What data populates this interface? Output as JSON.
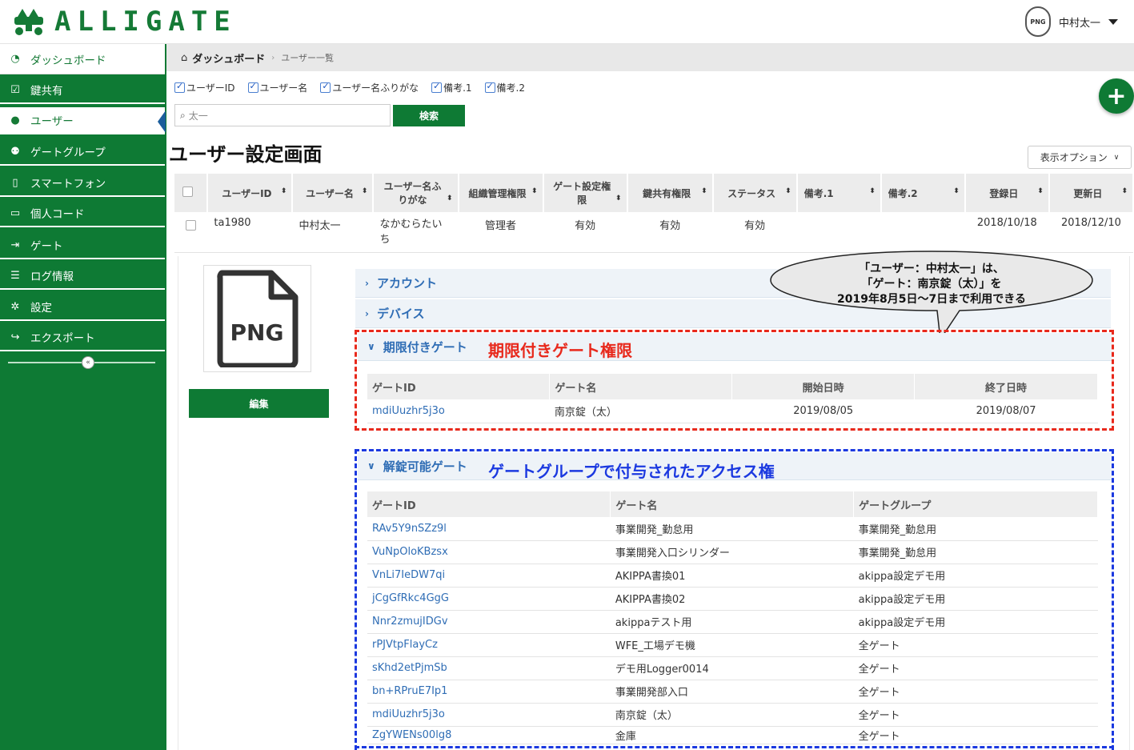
{
  "app": {
    "logo_text": "ALLIGATE"
  },
  "header": {
    "avatar_label": "PNG",
    "user_name": "中村太一"
  },
  "sidebar": {
    "items": [
      {
        "label": "ダッシュボード",
        "icon": "dashboard-icon"
      },
      {
        "label": "鍵共有",
        "icon": "check-square-icon"
      },
      {
        "label": "ユーザー",
        "icon": "user-icon"
      },
      {
        "label": "ゲートグループ",
        "icon": "users-icon"
      },
      {
        "label": "スマートフォン",
        "icon": "mobile-icon"
      },
      {
        "label": "個人コード",
        "icon": "card-icon"
      },
      {
        "label": "ゲート",
        "icon": "sign-in-icon"
      },
      {
        "label": "ログ情報",
        "icon": "list-icon"
      },
      {
        "label": "設定",
        "icon": "gear-icon"
      },
      {
        "label": "エクスポート",
        "icon": "share-icon"
      }
    ]
  },
  "breadcrumb": {
    "home": "ダッシュボード",
    "current": "ユーザー一覧"
  },
  "filters": {
    "checkboxes": [
      "ユーザーID",
      "ユーザー名",
      "ユーザー名ふりがな",
      "備考.1",
      "備考.2"
    ],
    "search_value": "太一",
    "search_button": "検索"
  },
  "page_title": "ユーザー設定画面",
  "view_options": "表示オプション",
  "users_table": {
    "headers": [
      "ユーザーID",
      "ユーザー名",
      "ユーザー名ふりがな",
      "組織管理権限",
      "ゲート設定権限",
      "鍵共有権限",
      "ステータス",
      "備考.1",
      "備考.2",
      "登録日",
      "更新日"
    ],
    "row": [
      "ta1980",
      "中村太一",
      "なかむらたいち",
      "管理者",
      "有効",
      "有効",
      "有効",
      "",
      "",
      "2018/10/18",
      "2018/12/10"
    ]
  },
  "detail": {
    "image_label": "PNG",
    "edit_button": "編集",
    "sections": {
      "account": "アカウント",
      "device": "デバイス",
      "timed": "期限付きゲート",
      "unlockable": "解錠可能ゲート"
    },
    "annotation_red": "期限付きゲート権限",
    "annotation_blue": "ゲートグループで付与されたアクセス権",
    "bubble": {
      "line1": "「ユーザー：中村太一」は、",
      "line2": "「ゲート：南京錠（太）」を",
      "line3": "2019年8月5日〜7日まで利用できる"
    },
    "timed_table": {
      "headers": [
        "ゲートID",
        "ゲート名",
        "開始日時",
        "終了日時"
      ],
      "rows": [
        [
          "mdiUuzhr5j3o",
          "南京錠（太）",
          "2019/08/05",
          "2019/08/07"
        ]
      ]
    },
    "unlock_table": {
      "headers": [
        "ゲートID",
        "ゲート名",
        "ゲートグループ"
      ],
      "rows": [
        [
          "RAv5Y9nSZz9l",
          "事業開発_勤怠用",
          "事業開発_勤怠用"
        ],
        [
          "VuNpOloKBzsx",
          "事業開発入口シリンダー",
          "事業開発_勤怠用"
        ],
        [
          "VnLi7IeDW7qi",
          "AKIPPA書換01",
          "akippa設定デモ用"
        ],
        [
          "jCgGfRkc4GgG",
          "AKIPPA書換02",
          "akippa設定デモ用"
        ],
        [
          "Nnr2zmujIDGv",
          "akippaテスト用",
          "akippa設定デモ用"
        ],
        [
          "rPJVtpFlayCz",
          "WFE_工場デモ機",
          "全ゲート"
        ],
        [
          "sKhd2etPjmSb",
          "デモ用Logger0014",
          "全ゲート"
        ],
        [
          "bn+RPruE7Ip1",
          "事業開発部入口",
          "全ゲート"
        ],
        [
          "mdiUuzhr5j3o",
          "南京錠（太）",
          "全ゲート"
        ],
        [
          "ZgYWENs00lg8",
          "金庫",
          "全ゲート"
        ]
      ]
    }
  }
}
